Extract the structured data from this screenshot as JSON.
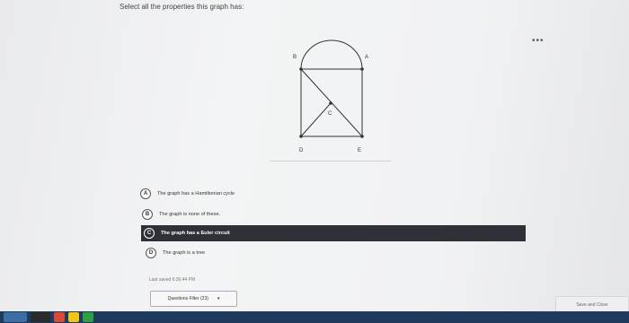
{
  "question": {
    "prompt": "Select all the properties this graph has:"
  },
  "menu": {
    "more_glyph": "•••"
  },
  "graph": {
    "vertex_labels": {
      "A": "A",
      "B": "B",
      "C": "C",
      "D": "D",
      "E": "E"
    },
    "edges": [
      [
        "B",
        "A"
      ],
      [
        "B",
        "A"
      ],
      [
        "B",
        "D"
      ],
      [
        "A",
        "E"
      ],
      [
        "D",
        "E"
      ],
      [
        "B",
        "E"
      ],
      [
        "D",
        "C"
      ]
    ],
    "arc_between": [
      "B",
      "A"
    ]
  },
  "options": [
    {
      "letter": "A",
      "text": "The graph has a Hamiltonian cycle",
      "selected": false
    },
    {
      "letter": "B",
      "text": "The graph is none of these.",
      "selected": false
    },
    {
      "letter": "C",
      "text": "The graph has a Euler circuit",
      "selected": true
    },
    {
      "letter": "D",
      "text": "The graph is a tree",
      "selected": false
    }
  ],
  "footer": {
    "last_saved": "Last saved 6:36:44 PM",
    "filter_label": "Questions Filter (23)",
    "filter_arrow": "▾",
    "save_close_label": "Save and Close"
  },
  "taskbar": {
    "colors": [
      "#3a6ea5",
      "#2b2b2b",
      "#d84a38",
      "#f0c419",
      "#2f9e44"
    ]
  }
}
